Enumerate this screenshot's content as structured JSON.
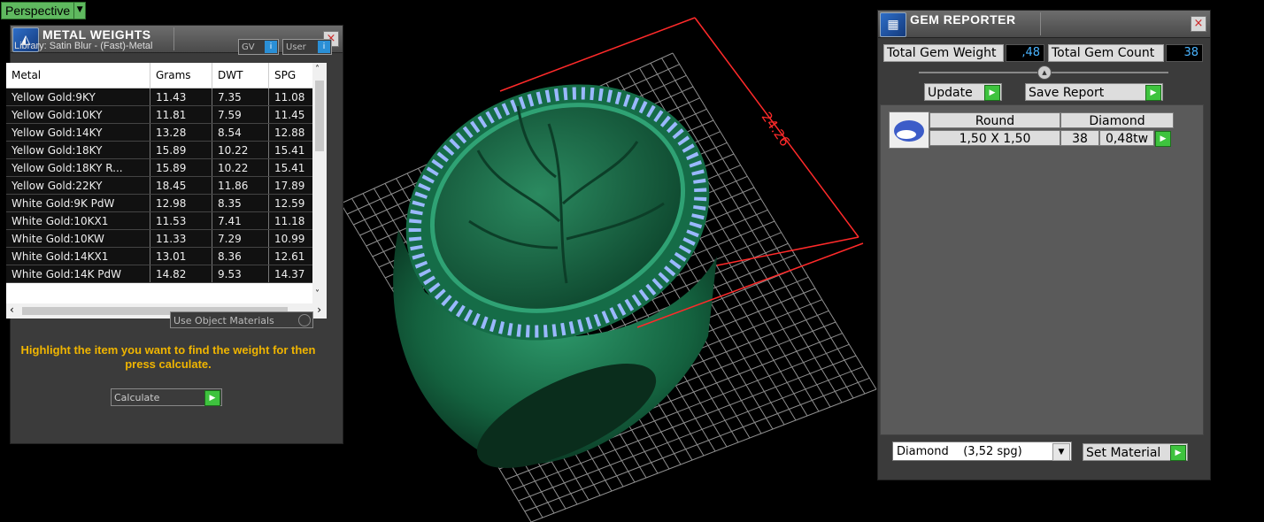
{
  "viewport": {
    "mode_label": "Perspective",
    "dimension_label": "24.26",
    "colors": {
      "ring": "#1f7a55",
      "grid": "#bfbfbf",
      "dimension": "#ff2a2a",
      "gems": "#9ab8ff"
    }
  },
  "metal_weights": {
    "title": "METAL WEIGHTS",
    "library": "Library: Satin Blur - (Fast)-Metal",
    "gv_label": "GV",
    "user_label": "User",
    "columns": [
      "Metal",
      "Grams",
      "DWT",
      "SPG"
    ],
    "rows": [
      [
        "Yellow Gold:9KY",
        "11.43",
        "7.35",
        "11.08"
      ],
      [
        "Yellow Gold:10KY",
        "11.81",
        "7.59",
        "11.45"
      ],
      [
        "Yellow Gold:14KY",
        "13.28",
        "8.54",
        "12.88"
      ],
      [
        "Yellow Gold:18KY",
        "15.89",
        "10.22",
        "15.41"
      ],
      [
        "Yellow Gold:18KY R...",
        "15.89",
        "10.22",
        "15.41"
      ],
      [
        "Yellow Gold:22KY",
        "18.45",
        "11.86",
        "17.89"
      ],
      [
        "White Gold:9K PdW",
        "12.98",
        "8.35",
        "12.59"
      ],
      [
        "White Gold:10KX1",
        "11.53",
        "7.41",
        "11.18"
      ],
      [
        "White Gold:10KW",
        "11.33",
        "7.29",
        "10.99"
      ],
      [
        "White Gold:14KX1",
        "13.01",
        "8.36",
        "12.61"
      ],
      [
        "White Gold:14K PdW",
        "14.82",
        "9.53",
        "14.37"
      ]
    ],
    "use_object_materials": "Use Object Materials",
    "hint": "Highlight the item you want to find the weight for then press calculate.",
    "calculate_label": "Calculate"
  },
  "gem_reporter": {
    "title": "GEM REPORTER",
    "total_weight_label": "Total Gem Weight",
    "total_weight_value": ",48",
    "total_count_label": "Total Gem Count",
    "total_count_value": "38",
    "update_label": "Update",
    "save_report_label": "Save Report",
    "gems": [
      {
        "shape": "Round",
        "material": "Diamond",
        "size": "1,50 X 1,50",
        "count": "38",
        "weight": "0,48tw"
      }
    ],
    "material_select": "Diamond    (3,52 spg)",
    "set_material_label": "Set Material"
  }
}
